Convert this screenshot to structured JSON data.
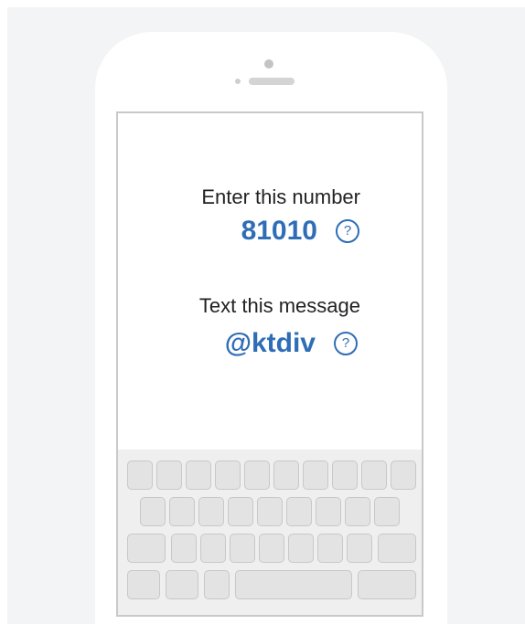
{
  "prompt": {
    "number_label": "Enter this number",
    "number_value": "81010",
    "message_label": "Text this message",
    "message_value": "@ktdiv",
    "help_glyph": "?"
  },
  "colors": {
    "accent": "#2f6db6",
    "background": "#f3f4f5",
    "key": "#e3e3e3"
  },
  "keyboard": {
    "rows": [
      10,
      9,
      9,
      5
    ]
  }
}
